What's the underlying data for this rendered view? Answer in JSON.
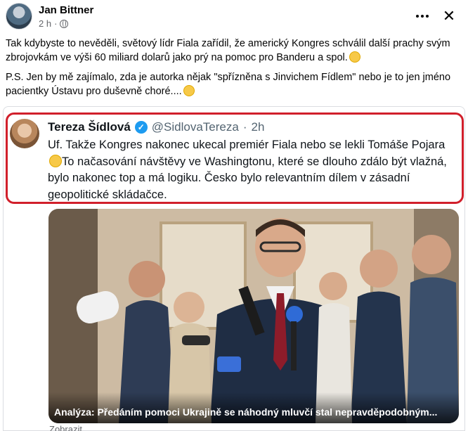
{
  "post": {
    "author": "Jan Bittner",
    "time": "2 h",
    "privacy_icon": "globe-icon",
    "more_icon": "more-options-icon",
    "close_icon": "close-icon",
    "paragraph1": "Tak kdybyste to nevěděli, světový lídr Fiala zařídil, že americký Kongres schválil další prachy svým zbrojovkám ve výši 60 miliard dolarů jako prý na pomoc pro Banderu a spol.",
    "paragraph1_emoji": "rofl-emoji-icon",
    "paragraph2": "P.S. Jen by mě zajímalo, zda je autorka nějak \"spřízněna s Jinvichem Fídlem\" nebo je to jen jméno pacientky Ústavu pro duševně choré....",
    "paragraph2_emoji": "thinking-emoji-icon"
  },
  "tweet": {
    "name": "Tereza Šídlová",
    "handle": "@SidlovaTereza",
    "separator": "·",
    "time": "2h",
    "body_part1": "Uf. Takže Kongres nakonec ukecal premiér Fiala nebo se lekli Tomáše Pojara",
    "body_emoji": "smile-emoji-icon",
    "body_part2": "To načasování návštěvy ve Washingtonu, které se dlouho zdálo být vlažná, bylo nakonec top a má logiku. Česko bylo relevantním dílem v zásadní geopolitické skládačce."
  },
  "article": {
    "caption": "Analýza: Předáním pomoci Ukrajině se náhodný mluvčí stal nepravděpodobným..."
  },
  "footer_peek": "Zobrazit..."
}
